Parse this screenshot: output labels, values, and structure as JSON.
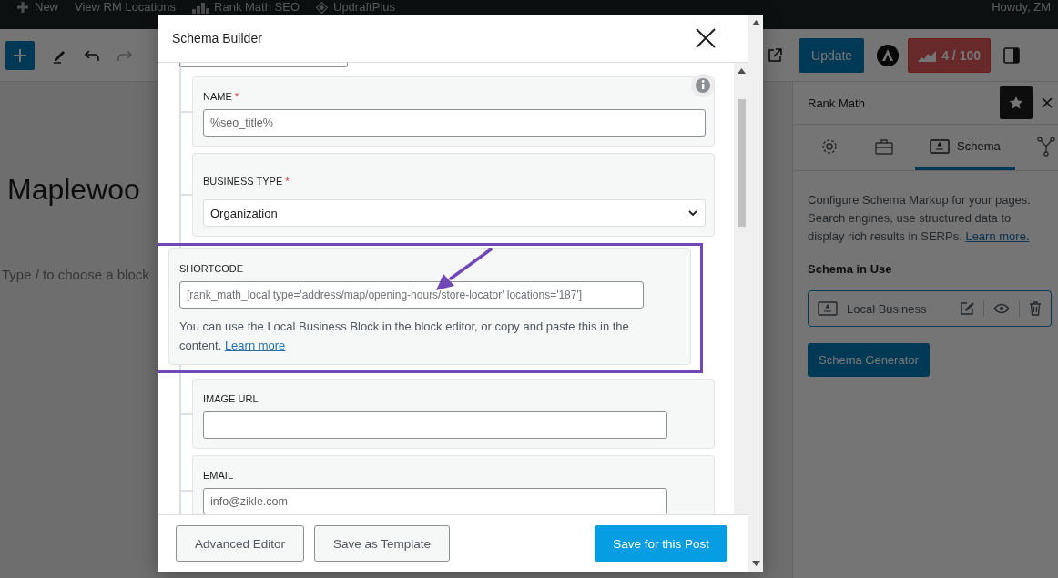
{
  "admin_bar": {
    "items": [
      {
        "kind": "new",
        "label": "New"
      },
      {
        "kind": "link",
        "label": "View RM Locations"
      },
      {
        "kind": "chart",
        "label": "Rank Math SEO"
      },
      {
        "kind": "diamond",
        "label": "UpdraftPlus"
      }
    ],
    "greeting": "Howdy, ZM"
  },
  "toolbar": {
    "update_button": "Update",
    "score_button": "4 / 100"
  },
  "canvas": {
    "title": "Maplewoo",
    "placeholder": "Type / to choose a block"
  },
  "sidebar": {
    "title": "Rank Math",
    "tabs": [
      {
        "kind": "settings",
        "selected": false
      },
      {
        "kind": "briefcase",
        "selected": false
      },
      {
        "kind": "schema",
        "label": "Schema",
        "selected": true
      },
      {
        "kind": "graph",
        "selected": false
      }
    ],
    "description": "Configure Schema Markup for your pages. Search engines, use structured data to display rich results in SERPs.",
    "description_link": "Learn more.",
    "section_title": "Schema in Use",
    "schema_item": "Local Business",
    "generator_button": "Schema Generator"
  },
  "modal": {
    "title": "Schema Builder",
    "fields": [
      {
        "kind": "input",
        "label": "NAME",
        "required_mark": "*",
        "value": "%seo_title%",
        "highlighted": false
      },
      {
        "kind": "select",
        "label": "BUSINESS TYPE",
        "required_mark": "*",
        "value": "Organization",
        "highlighted": false
      },
      {
        "kind": "shortcode",
        "label": "SHORTCODE",
        "value": "[rank_math_local type='address/map/opening-hours/store-locator' locations='187']",
        "help": "You can use the Local Business Block in the block editor, or copy and paste this in the content.",
        "help_link": "Learn more",
        "highlighted": true
      },
      {
        "kind": "input",
        "label": "IMAGE URL",
        "highlighted": false
      },
      {
        "kind": "input",
        "label": "EMAIL",
        "value": "info@zikle.com",
        "highlighted": false
      }
    ],
    "buttons": [
      {
        "kind": "secondary",
        "label": "Advanced Editor"
      },
      {
        "kind": "secondary",
        "label": "Save as Template"
      },
      {
        "kind": "primary",
        "label": "Save for this Post"
      }
    ]
  }
}
